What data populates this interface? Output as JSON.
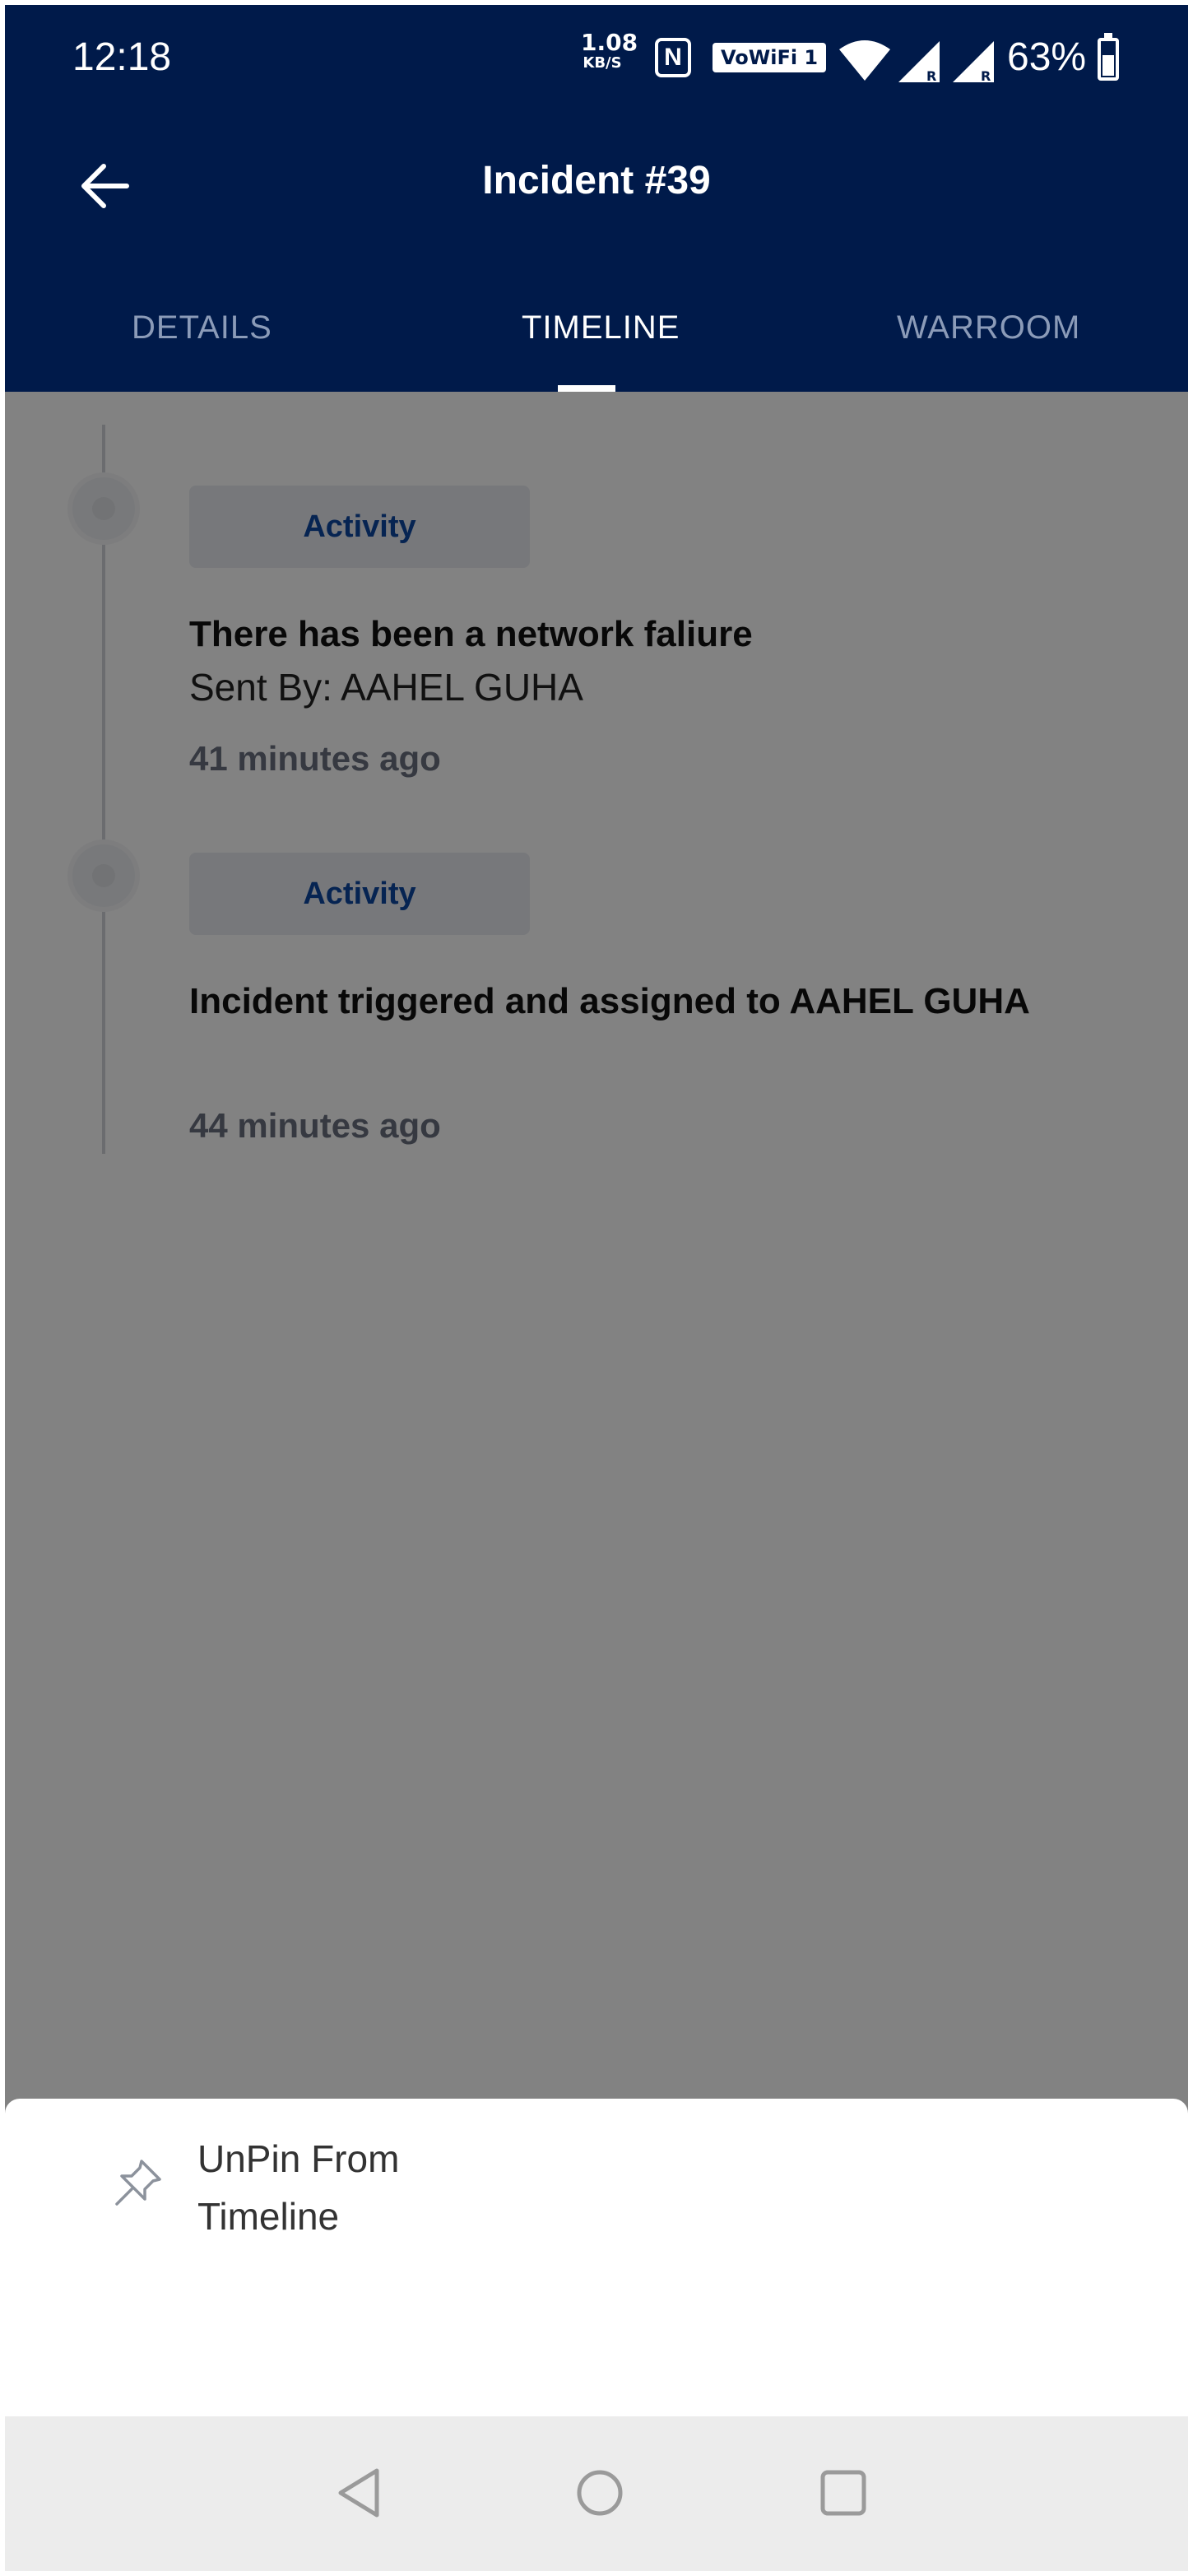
{
  "status_bar": {
    "time": "12:18",
    "net_speed_value": "1.08",
    "net_speed_unit": "KB/S",
    "nfc_label": "N",
    "wifi_calling_label": "VoWiFi 1",
    "battery_percent": "63%",
    "battery_level": 0.63
  },
  "header": {
    "title": "Incident #39",
    "back_icon": "arrow-left-icon"
  },
  "tabs": [
    {
      "label": "DETAILS",
      "active": false
    },
    {
      "label": "TIMELINE",
      "active": true
    },
    {
      "label": "WARROOM",
      "active": false
    }
  ],
  "timeline": [
    {
      "chip": "Activity",
      "title": "There has been a network faliure",
      "sent_by": "Sent By: AAHEL GUHA",
      "time": "41 minutes ago"
    },
    {
      "chip": "Activity",
      "title": "Incident triggered and assigned to AAHEL GUHA",
      "time": "44 minutes ago"
    }
  ],
  "bottom_sheet": {
    "action_label": "UnPin From Timeline",
    "action_icon": "pin-icon"
  },
  "nav_bar": {
    "back_icon": "nav-back-icon",
    "home_icon": "nav-home-icon",
    "recents_icon": "nav-recents-icon"
  },
  "colors": {
    "header_bg": "#001a4a",
    "chip_text": "#0d47a1",
    "scrim": "rgba(0,0,0,0.49)"
  }
}
